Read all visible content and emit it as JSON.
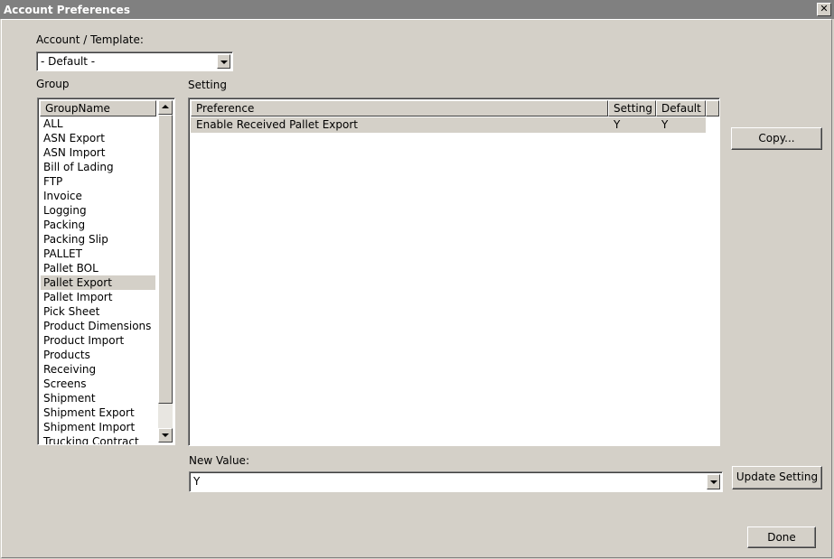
{
  "window": {
    "title": "Account Preferences",
    "close_glyph": "✕"
  },
  "account_template": {
    "label": "Account / Template:",
    "selected": "- Default -"
  },
  "group": {
    "label": "Group",
    "column_header": "GroupName",
    "items": [
      "ALL",
      "ASN Export",
      "ASN Import",
      "Bill of Lading",
      "FTP",
      "Invoice",
      "Logging",
      "Packing",
      "Packing Slip",
      "PALLET",
      "Pallet BOL",
      "Pallet Export",
      "Pallet Import",
      "Pick Sheet",
      "Product Dimensions",
      "Product Import",
      "Products",
      "Receiving",
      "Screens",
      "Shipment",
      "Shipment Export",
      "Shipment Import",
      "Trucking Contract"
    ],
    "selected_index": 11
  },
  "setting": {
    "label": "Setting",
    "columns": [
      "Preference",
      "Setting",
      "Default"
    ],
    "rows": [
      {
        "preference": "Enable Received Pallet Export",
        "setting": "Y",
        "default": "Y"
      }
    ]
  },
  "new_value": {
    "label": "New Value:",
    "selected": "Y"
  },
  "buttons": {
    "copy": "Copy...",
    "update": "Update Setting",
    "done": "Done"
  }
}
